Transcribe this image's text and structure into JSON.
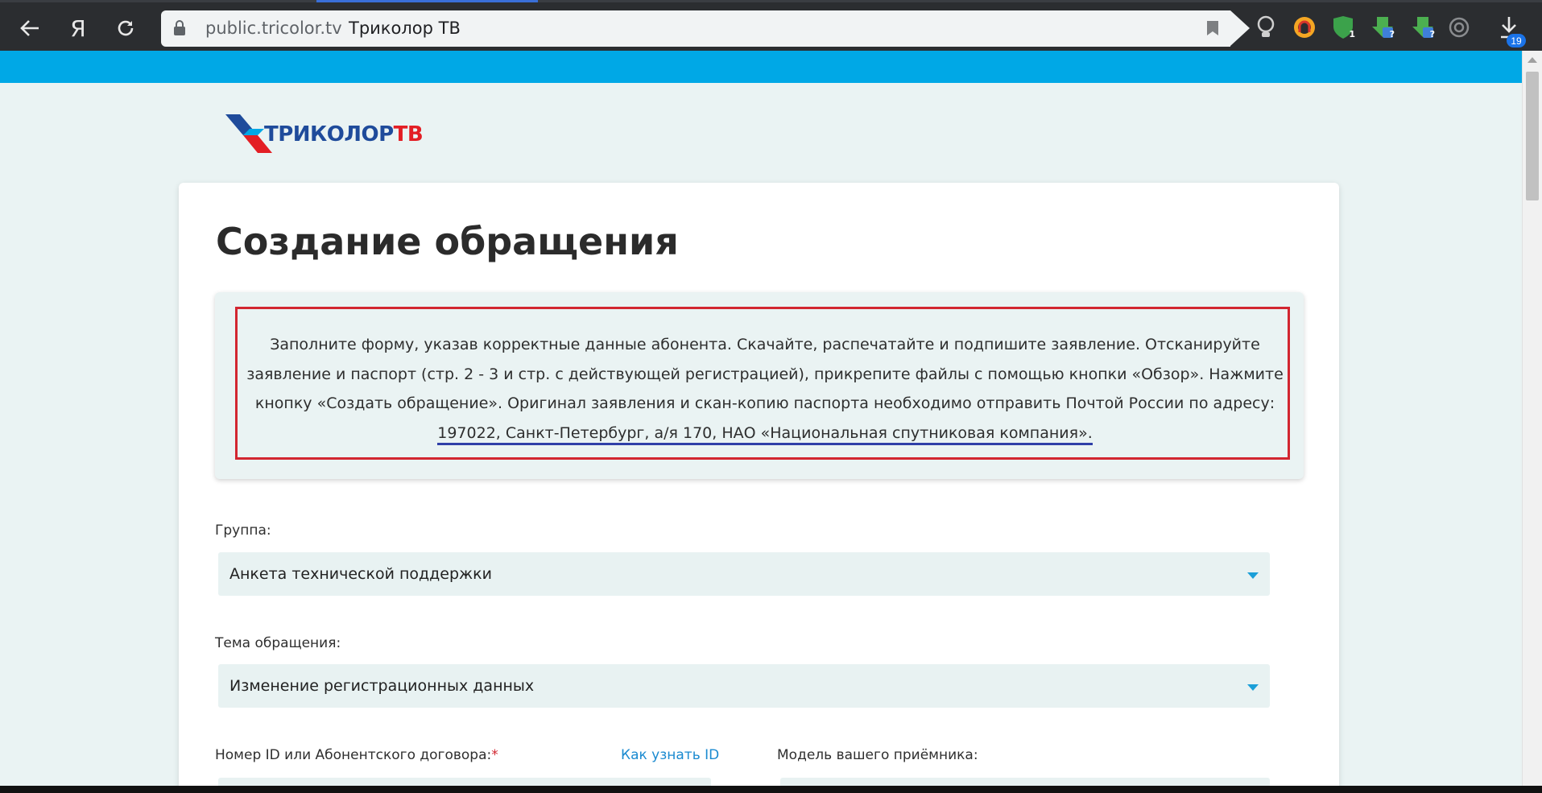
{
  "browser": {
    "url": "public.tricolor.tv",
    "page_title": "Триколор ТВ",
    "downloads_badge": "19",
    "ext_badge_1": "1",
    "ext_badge_2": "?",
    "ext_badge_3": "?",
    "yandex_glyph": "Я"
  },
  "brand": {
    "logo_text_main": "ТРИКОЛОР",
    "logo_text_tv": "ТВ",
    "blue": "#00a8e6",
    "red": "#d22630",
    "navy": "#1f4b9b"
  },
  "page": {
    "title": "Создание обращения",
    "info_lines": [
      "Заполните форму, указав корректные данные абонента. Скачайте, распечатайте и подпишите заявление. Отсканируйте",
      "заявление и паспорт (стр. 2 - 3 и стр. с действующей регистрацией), прикрепите файлы с помощью кнопки «Обзор». Нажмите",
      "кнопку «Создать обращение». Оригинал заявления и скан-копию паспорта необходимо отправить Почтой России по адресу:"
    ],
    "info_address": "197022, Санкт-Петербург, а/я 170, НАО «Национальная спутниковая компания».",
    "group_label": "Группа:",
    "group_value": "Анкета технической поддержки",
    "topic_label": "Тема обращения:",
    "topic_value": "Изменение регистрационных данных",
    "id_label": "Номер ID или Абонентского договора:",
    "required_mark": "*",
    "how_to_id_link": "Как узнать ID",
    "receiver_label": "Модель вашего приёмника:"
  }
}
